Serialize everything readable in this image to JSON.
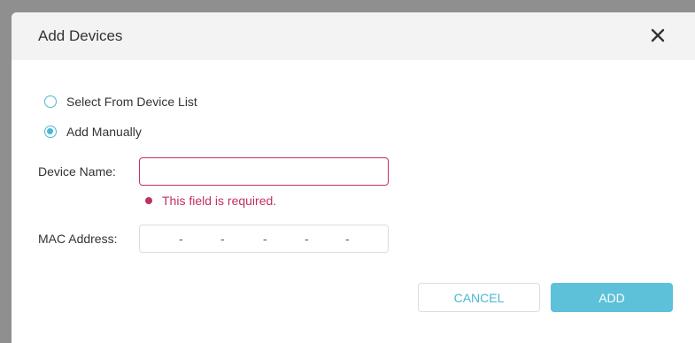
{
  "dialog": {
    "title": "Add Devices",
    "close_icon": "close-icon"
  },
  "options": {
    "select_from_list": "Select From Device List",
    "add_manually": "Add Manually",
    "selected": "add_manually"
  },
  "form": {
    "device_name_label": "Device Name:",
    "device_name_value": "",
    "error_text": "This field is required.",
    "mac_label": "MAC Address:",
    "mac_separators": [
      "-",
      "-",
      "-",
      "-",
      "-"
    ]
  },
  "buttons": {
    "cancel": "CANCEL",
    "add": "ADD"
  },
  "colors": {
    "accent": "#4ab8d2",
    "error": "#c1315d",
    "add_button": "#5cc1d9"
  }
}
